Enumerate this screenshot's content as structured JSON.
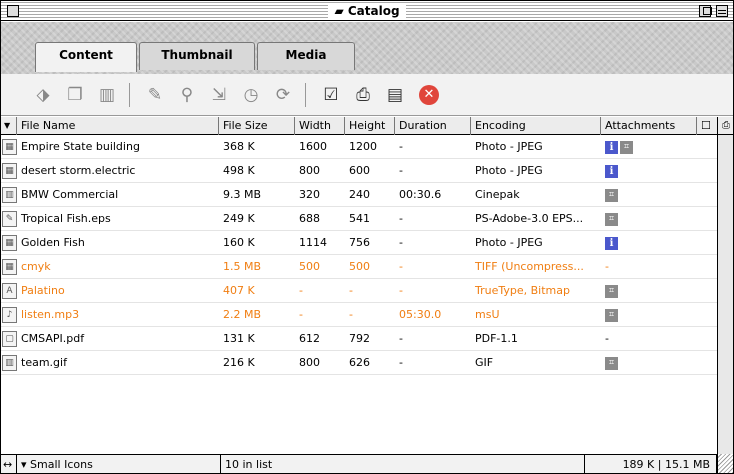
{
  "window": {
    "title": "Catalog",
    "title_icon": "book-icon"
  },
  "tabs": [
    {
      "label": "Content",
      "active": true
    },
    {
      "label": "Thumbnail",
      "active": false
    },
    {
      "label": "Media",
      "active": false
    }
  ],
  "toolbar": {
    "icons": [
      "catalog-add-icon",
      "open-folder-icon",
      "trash-icon",
      "edit-tag-icon",
      "find-icon",
      "move-icon",
      "time-icon",
      "sync-icon",
      "get-info-icon",
      "print-icon",
      "clapper-icon",
      "stop-icon"
    ]
  },
  "table": {
    "sort_glyph": "▼",
    "columns": [
      "File Name",
      "File Size",
      "Width",
      "Height",
      "Duration",
      "Encoding",
      "Attachments"
    ],
    "rows": [
      {
        "icon": "picture-file-icon",
        "name": "Empire State building",
        "size": "368 K",
        "width": "1600",
        "height": "1200",
        "duration": "-",
        "encoding": "Photo - JPEG",
        "att": "info,kind",
        "highlight": false
      },
      {
        "icon": "picture-file-icon",
        "name": "desert storm.electric",
        "size": "498 K",
        "width": "800",
        "height": "600",
        "duration": "-",
        "encoding": "Photo - JPEG",
        "att": "info",
        "highlight": false
      },
      {
        "icon": "movie-file-icon",
        "name": "BMW Commercial",
        "size": "9.3 MB",
        "width": "320",
        "height": "240",
        "duration": "00:30.6",
        "encoding": "Cinepak",
        "att": "kind",
        "highlight": false
      },
      {
        "icon": "eps-file-icon",
        "name": "Tropical Fish.eps",
        "size": "249 K",
        "width": "688",
        "height": "541",
        "duration": "-",
        "encoding": "PS-Adobe-3.0 EPS...",
        "att": "kind",
        "highlight": false
      },
      {
        "icon": "picture-file-icon",
        "name": "Golden Fish",
        "size": "160 K",
        "width": "1114",
        "height": "756",
        "duration": "-",
        "encoding": "Photo - JPEG",
        "att": "info",
        "highlight": false
      },
      {
        "icon": "picture-file-icon",
        "name": "cmyk",
        "size": "1.5 MB",
        "width": "500",
        "height": "500",
        "duration": "-",
        "encoding": "TIFF (Uncompress...",
        "att": "dash",
        "highlight": true
      },
      {
        "icon": "font-file-icon",
        "name": "Palatino",
        "size": "407 K",
        "width": "-",
        "height": "-",
        "duration": "-",
        "encoding": "TrueType, Bitmap",
        "att": "kind",
        "highlight": true
      },
      {
        "icon": "audio-file-icon",
        "name": "listen.mp3",
        "size": "2.2 MB",
        "width": "-",
        "height": "-",
        "duration": "05:30.0",
        "encoding": "msU",
        "att": "kind",
        "highlight": true
      },
      {
        "icon": "pdf-file-icon",
        "name": "CMSAPI.pdf",
        "size": "131 K",
        "width": "612",
        "height": "792",
        "duration": "-",
        "encoding": "PDF-1.1",
        "att": "dash",
        "highlight": false
      },
      {
        "icon": "gif-file-icon",
        "name": "team.gif",
        "size": "216 K",
        "width": "800",
        "height": "626",
        "duration": "-",
        "encoding": "GIF",
        "att": "kind",
        "highlight": false
      }
    ]
  },
  "status": {
    "view_label": "Small Icons",
    "count_label": "10 in list",
    "size_label": "189 K  |  15.1 MB"
  },
  "colors": {
    "highlight": "#f07e12",
    "info": "#4b58cc",
    "stop": "#e0453b"
  }
}
